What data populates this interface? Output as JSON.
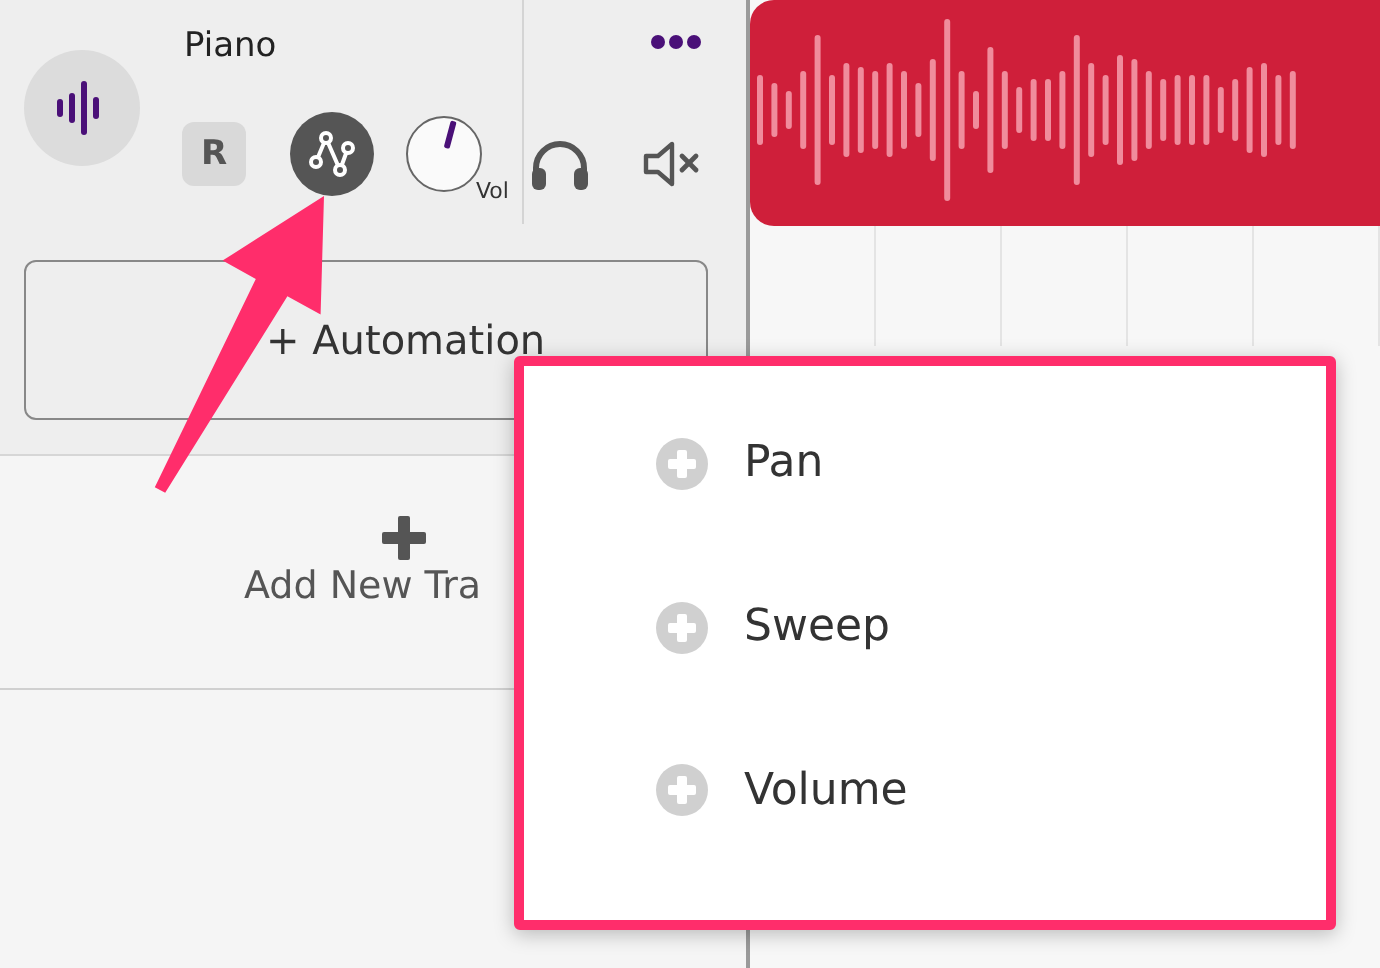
{
  "track": {
    "name": "Piano",
    "record_label": "R",
    "volume": {
      "label": "Vol"
    }
  },
  "automation_button": "+ Automation",
  "add_track": "Add New Tra",
  "automation_menu": {
    "items": [
      {
        "label": "Pan"
      },
      {
        "label": "Sweep"
      },
      {
        "label": "Volume"
      }
    ]
  }
}
